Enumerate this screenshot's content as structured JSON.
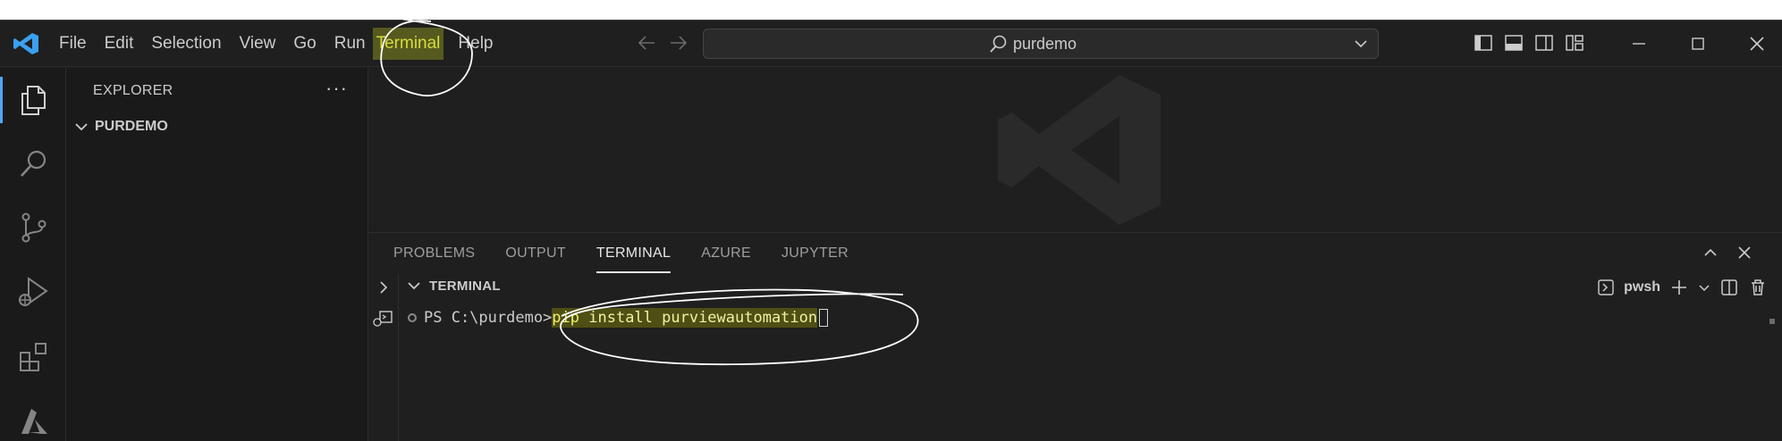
{
  "titlebar": {
    "menu": [
      "File",
      "Edit",
      "Selection",
      "View",
      "Go",
      "Run",
      "Terminal",
      "Help"
    ],
    "search_text": "purdemo"
  },
  "sidebar": {
    "title": "EXPLORER",
    "more": "···",
    "folder": "PURDEMO"
  },
  "panel": {
    "tabs": [
      "PROBLEMS",
      "OUTPUT",
      "TERMINAL",
      "AZURE",
      "JUPYTER"
    ],
    "active_tab": "TERMINAL",
    "terminal_section_title": "TERMINAL",
    "shell_label": "pwsh",
    "prompt": "PS C:\\purdemo>",
    "command_part1": "pip",
    "command_part2": " install purviewautomation"
  },
  "colors": {
    "accent": "#4fa8ff",
    "highlight": "#565a1e",
    "highlight_text": "#d7dc3c",
    "background": "#1f1f1f"
  }
}
